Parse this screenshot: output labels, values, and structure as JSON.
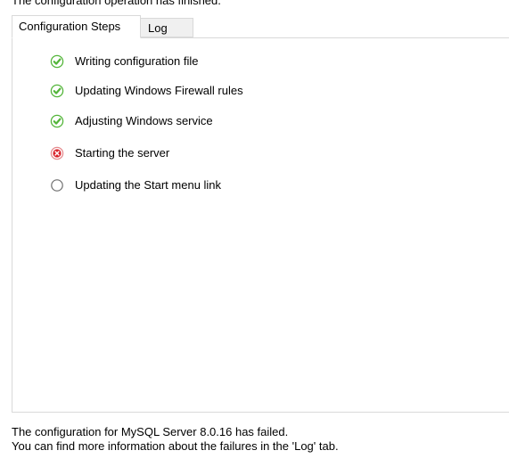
{
  "header": {
    "status_text": "The configuration operation has finished."
  },
  "tabs": [
    {
      "label": "Configuration Steps",
      "selected": true
    },
    {
      "label": "Log",
      "selected": false
    }
  ],
  "steps": [
    {
      "label": "Writing configuration file",
      "status": "success",
      "icon": "check-circle-icon"
    },
    {
      "label": "Updating Windows Firewall rules",
      "status": "success",
      "icon": "check-circle-icon"
    },
    {
      "label": "Adjusting Windows service",
      "status": "success",
      "icon": "check-circle-icon"
    },
    {
      "label": "Starting the server",
      "status": "failed",
      "icon": "error-x-circle-icon"
    },
    {
      "label": "Updating the Start menu link",
      "status": "pending",
      "icon": "empty-circle-icon"
    }
  ],
  "footer": {
    "line1": "The configuration for MySQL Server 8.0.16 has failed.",
    "line2": "You can find more information about the failures in the 'Log' tab."
  },
  "colors": {
    "success": "#53b53a",
    "failed": "#d9222a",
    "pending_border": "#7a7a7a",
    "tab_border": "#d9d9d9",
    "inactive_tab_bg": "#f0f0f0"
  }
}
